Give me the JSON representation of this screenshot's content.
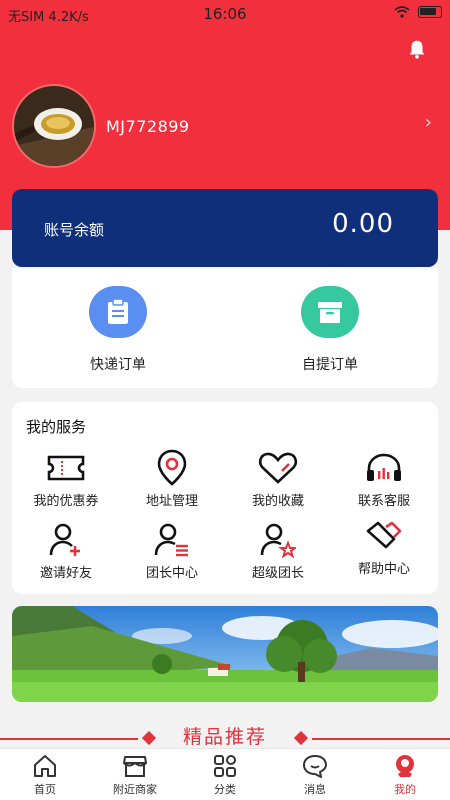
{
  "status_bar": {
    "carrier": "无SIM 4.2K/s",
    "time": "16:06"
  },
  "profile": {
    "username": "MJ772899"
  },
  "balance": {
    "label": "账号余额",
    "value": "0.00"
  },
  "orders": [
    {
      "label": "快递订单",
      "icon": "clipboard-icon",
      "color": "#5a8ef0"
    },
    {
      "label": "自提订单",
      "icon": "archive-box-icon",
      "color": "#36c9a0"
    }
  ],
  "services": {
    "title": "我的服务",
    "items": [
      {
        "label": "我的优惠券",
        "icon": "ticket-icon"
      },
      {
        "label": "地址管理",
        "icon": "location-pin-icon"
      },
      {
        "label": "我的收藏",
        "icon": "heart-icon"
      },
      {
        "label": "联系客服",
        "icon": "headset-icon"
      },
      {
        "label": "邀请好友",
        "icon": "user-add-icon"
      },
      {
        "label": "团长中心",
        "icon": "user-list-icon"
      },
      {
        "label": "超级团长",
        "icon": "user-star-icon"
      },
      {
        "label": "帮助中心",
        "icon": "handshake-icon"
      }
    ]
  },
  "recommend": {
    "title": "精品推荐"
  },
  "tabbar": [
    {
      "label": "首页",
      "icon": "home-icon",
      "active": false
    },
    {
      "label": "附近商家",
      "icon": "store-icon",
      "active": false
    },
    {
      "label": "分类",
      "icon": "grid-icon",
      "active": false
    },
    {
      "label": "消息",
      "icon": "chat-icon",
      "active": false
    },
    {
      "label": "我的",
      "icon": "profile-icon",
      "active": true
    }
  ],
  "colors": {
    "brand_red": "#f2303d",
    "balance_navy": "#0f2f7a",
    "accent_red": "#e2333d"
  }
}
